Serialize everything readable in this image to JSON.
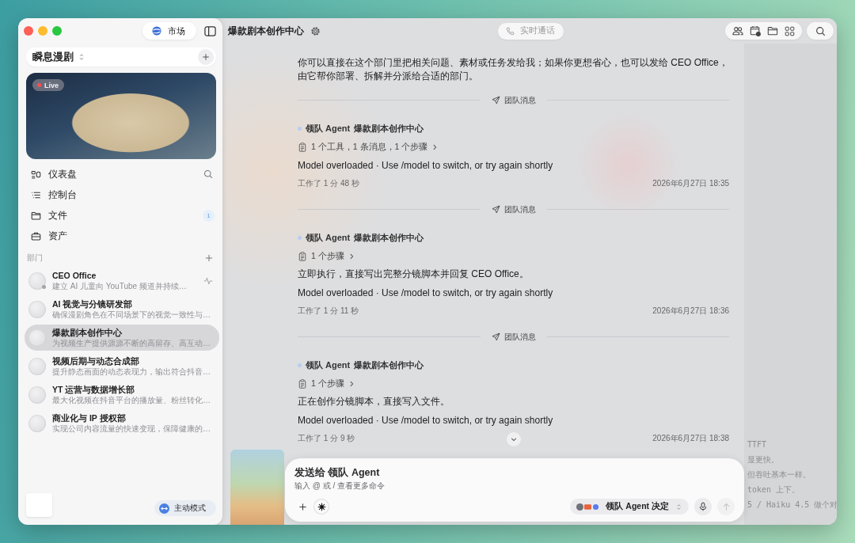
{
  "window": {
    "title": "爆款剧本创作中心"
  },
  "sidebar": {
    "market_button": "市场",
    "workspace": "瞬息漫剧",
    "live_badge": "Live",
    "nav": [
      {
        "label": "仪表盘"
      },
      {
        "label": "控制台"
      },
      {
        "label": "文件",
        "badge": "1"
      },
      {
        "label": "资产"
      }
    ],
    "section_label": "部门",
    "departments": [
      {
        "name": "CEO Office",
        "description": "建立 AI 儿童向 YouTube 频道并持续…",
        "selected": false,
        "working": true
      },
      {
        "name": "AI 视觉与分镜研发部",
        "description": "确保漫剧角色在不同场景下的视觉一致性与…",
        "selected": false,
        "working": false
      },
      {
        "name": "爆款剧本创作中心",
        "description": "为视频生产提供源源不断的高留存、高互动…",
        "selected": true,
        "working": false
      },
      {
        "name": "视频后期与动态合成部",
        "description": "提升静态画面的动态表现力，输出符合抖音…",
        "selected": false,
        "working": false
      },
      {
        "name": "YT 运营与数据增长部",
        "description": "最大化视频在抖音平台的播放量、粉丝转化…",
        "selected": false,
        "working": false
      },
      {
        "name": "商业化与 IP 授权部",
        "description": "实现公司内容流量的快速变现，保障健康的…",
        "selected": false,
        "working": false
      }
    ],
    "mode_button": "主动模式"
  },
  "call_button": {
    "label": "实时通话",
    "disabled": true
  },
  "timeline": [
    {
      "kind": "text",
      "text": "你可以直接在这个部门里把相关问题、素材或任务发给我；如果你更想省心，也可以发给 CEO Office，由它帮你部署、拆解并分派给合适的部门。"
    },
    {
      "kind": "divider",
      "label": "团队消息"
    },
    {
      "kind": "message",
      "sender": "领队 Agent",
      "department": "爆款剧本创作中心",
      "steps": "1 个工具，1 条消息，1 个步骤",
      "lines": [
        "Model overloaded · Use /model to switch, or try again shortly"
      ],
      "duration": "工作了 1 分 48 秒",
      "time": "2026年6月27日 18:35"
    },
    {
      "kind": "divider",
      "label": "团队消息"
    },
    {
      "kind": "message",
      "sender": "领队 Agent",
      "department": "爆款剧本创作中心",
      "steps": "1 个步骤",
      "lines": [
        "立即执行，直接写出完整分镜脚本并回复 CEO Office。",
        "Model overloaded · Use /model to switch, or try again shortly"
      ],
      "duration": "工作了 1 分 11 秒",
      "time": "2026年6月27日 18:36"
    },
    {
      "kind": "divider",
      "label": "团队消息"
    },
    {
      "kind": "message",
      "sender": "领队 Agent",
      "department": "爆款剧本创作中心",
      "steps": "1 个步骤",
      "lines": [
        "正在创作分镜脚本，直接写入文件。",
        "Model overloaded · Use /model to switch, or try again shortly"
      ],
      "duration": "工作了 1 分 9 秒",
      "time": "2026年6月27日 18:38"
    }
  ],
  "composer": {
    "recipient": "发送给 领队 Agent",
    "placeholder": "输入 @ 或 / 查看更多命令",
    "model_selector": "领队 Agent 决定",
    "send_disabled": true
  },
  "background_window": {
    "lines": [
      "TTFT",
      "显更快。",
      "但吞吐基本一样。",
      "token 上下。",
      "5 / Haiku 4.5 做个对"
    ]
  }
}
